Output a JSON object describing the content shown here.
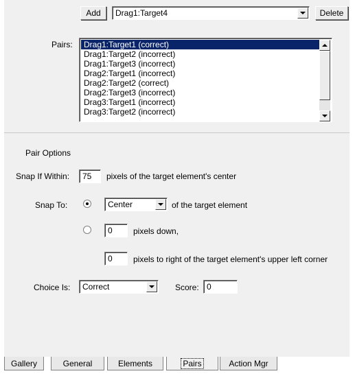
{
  "toolbar": {
    "add_label": "Add",
    "pair_value": "Drag1:Target4",
    "delete_label": "Delete"
  },
  "pairs": {
    "label": "Pairs:",
    "items": [
      "Drag1:Target1 (correct)",
      "Drag1:Target2 (incorrect)",
      "Drag1:Target3 (incorrect)",
      "Drag2:Target1 (incorrect)",
      "Drag2:Target2 (correct)",
      "Drag2:Target3 (incorrect)",
      "Drag3:Target1 (incorrect)",
      "Drag3:Target2 (incorrect)"
    ],
    "selected_index": 0
  },
  "options": {
    "heading": "Pair Options",
    "snap_within_label": "Snap If Within:",
    "snap_within_value": "75",
    "snap_within_suffix": "pixels of the target element's center",
    "snap_to_label": "Snap To:",
    "snap_to_value": "Center",
    "snap_to_suffix": "of the target element",
    "down_value": "0",
    "down_suffix": "pixels down,",
    "right_value": "0",
    "right_suffix": "pixels to right of the target element's upper left corner",
    "choice_label": "Choice Is:",
    "choice_value": "Correct",
    "score_label": "Score:",
    "score_value": "0"
  },
  "tabs": [
    {
      "label": "Gallery",
      "active": false
    },
    {
      "label": "General",
      "active": false
    },
    {
      "label": "Elements",
      "active": false
    },
    {
      "label": "Pairs",
      "active": true
    },
    {
      "label": "Action Mgr",
      "active": false
    }
  ]
}
